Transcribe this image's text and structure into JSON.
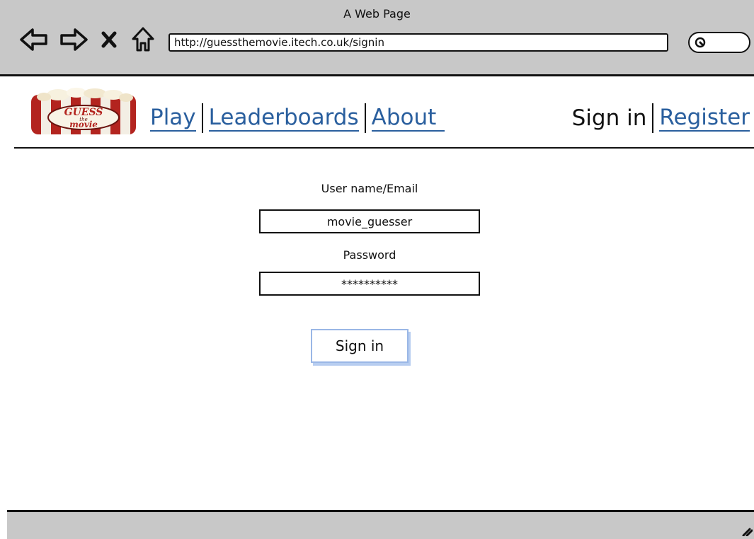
{
  "window": {
    "title": "A Web Page",
    "url": "http://guessthemovie.itech.co.uk/signin"
  },
  "icons": {
    "back": "back-arrow-icon",
    "forward": "forward-arrow-icon",
    "stop": "close-icon",
    "home": "home-icon",
    "search": "search-icon",
    "resize": "resize-grip-icon"
  },
  "site": {
    "logo_text": [
      "GUESS",
      "the",
      "movie"
    ],
    "nav": [
      {
        "label": "Play"
      },
      {
        "label": "Leaderboards"
      },
      {
        "label": "About"
      }
    ],
    "auth": {
      "current": "Sign in",
      "register": "Register"
    }
  },
  "form": {
    "username_label": "User name/Email",
    "username_value": "movie_guesser",
    "password_label": "Password",
    "password_value": "**********",
    "submit_label": "Sign in"
  },
  "colors": {
    "chrome_bg": "#c8c8c8",
    "link": "#2a5f9e",
    "button_border": "#9ab7e6"
  }
}
